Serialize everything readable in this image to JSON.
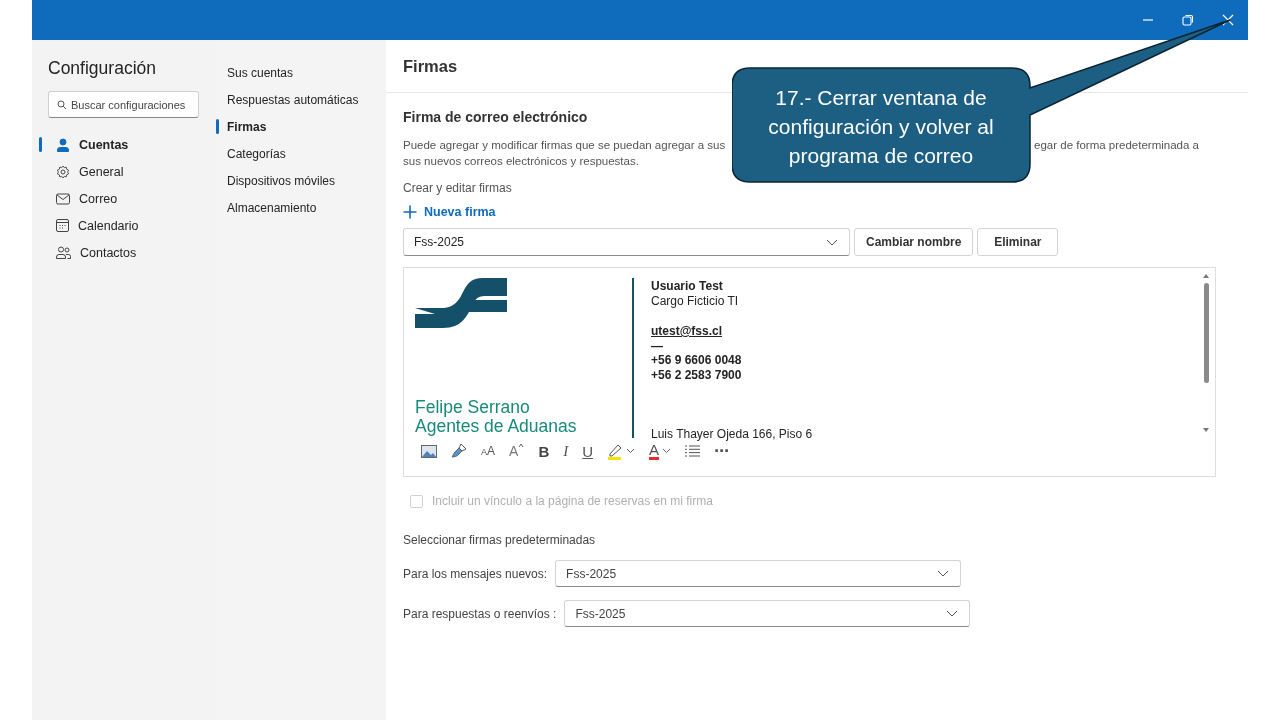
{
  "window": {
    "controls": [
      {
        "kind": "minimize"
      },
      {
        "kind": "restore"
      },
      {
        "kind": "close"
      }
    ]
  },
  "sidebar": {
    "title": "Configuración",
    "search": {
      "placeholder": "Buscar configuraciones"
    },
    "items": [
      {
        "kind": "person",
        "label": "Cuentas",
        "selected": true
      },
      {
        "kind": "gear",
        "label": "General",
        "selected": false
      },
      {
        "kind": "mail",
        "label": "Correo",
        "selected": false
      },
      {
        "kind": "calendar",
        "label": "Calendario",
        "selected": false
      },
      {
        "kind": "people",
        "label": "Contactos",
        "selected": false
      }
    ]
  },
  "subnav": {
    "items": [
      {
        "label": "Sus cuentas",
        "selected": false
      },
      {
        "label": "Respuestas automáticas",
        "selected": false
      },
      {
        "label": "Firmas",
        "selected": true
      },
      {
        "label": "Categorías",
        "selected": false
      },
      {
        "label": "Dispositivos móviles",
        "selected": false
      },
      {
        "label": "Almacenamiento",
        "selected": false
      }
    ]
  },
  "content": {
    "title": "Firmas",
    "section_title": "Firma de correo electrónico",
    "description": {
      "line_1_left": "Puede agregar y modificar firmas que se puedan agregar a sus",
      "line_1_right": "egar de forma predeterminada a",
      "line_2": "sus nuevos correos electrónicos y respuestas."
    },
    "create_label": "Crear y editar firmas",
    "new_signature": "Nueva firma",
    "signature_select": {
      "value": "Fss-2025"
    },
    "buttons": [
      "Cambiar nombre",
      "Eliminar"
    ],
    "signature": {
      "company_lines": [
        "Felipe Serrano",
        "Agentes de Aduanas"
      ],
      "name": "Usuario Test",
      "role": "Cargo Ficticio TI",
      "email": "utest@fss.cl",
      "separator": "—",
      "phones": [
        "+56 9 6606 0048",
        "+56 2 2583 7900"
      ],
      "address": "Luis Thayer Ojeda 166, Piso 6"
    },
    "toolbar": [
      {
        "kind": "image"
      },
      {
        "kind": "brush"
      },
      {
        "kind": "fontsize",
        "label": "AA"
      },
      {
        "kind": "grow",
        "label": "A"
      },
      {
        "kind": "bold",
        "label": "B"
      },
      {
        "kind": "italic",
        "label": "I"
      },
      {
        "kind": "underline",
        "label": "U"
      },
      {
        "kind": "highlight",
        "color": "#f2e600"
      },
      {
        "kind": "fontcolor",
        "label": "A",
        "color": "#e0302f"
      },
      {
        "kind": "list"
      },
      {
        "kind": "more",
        "label": "⋯"
      }
    ],
    "booking_checkbox": {
      "label": "Incluir un vínculo a la página de reservas en mi firma",
      "checked": false,
      "disabled": true
    },
    "defaults_title": "Seleccionar firmas predeterminadas",
    "defaults": [
      {
        "label": "Para los mensajes nuevos:",
        "value": "Fss-2025"
      },
      {
        "label": "Para respuestas o reenvíos :",
        "value": "Fss-2025"
      }
    ]
  },
  "callout": {
    "text": "17.- Cerrar ventana de configuración y volver al programa de correo"
  }
}
